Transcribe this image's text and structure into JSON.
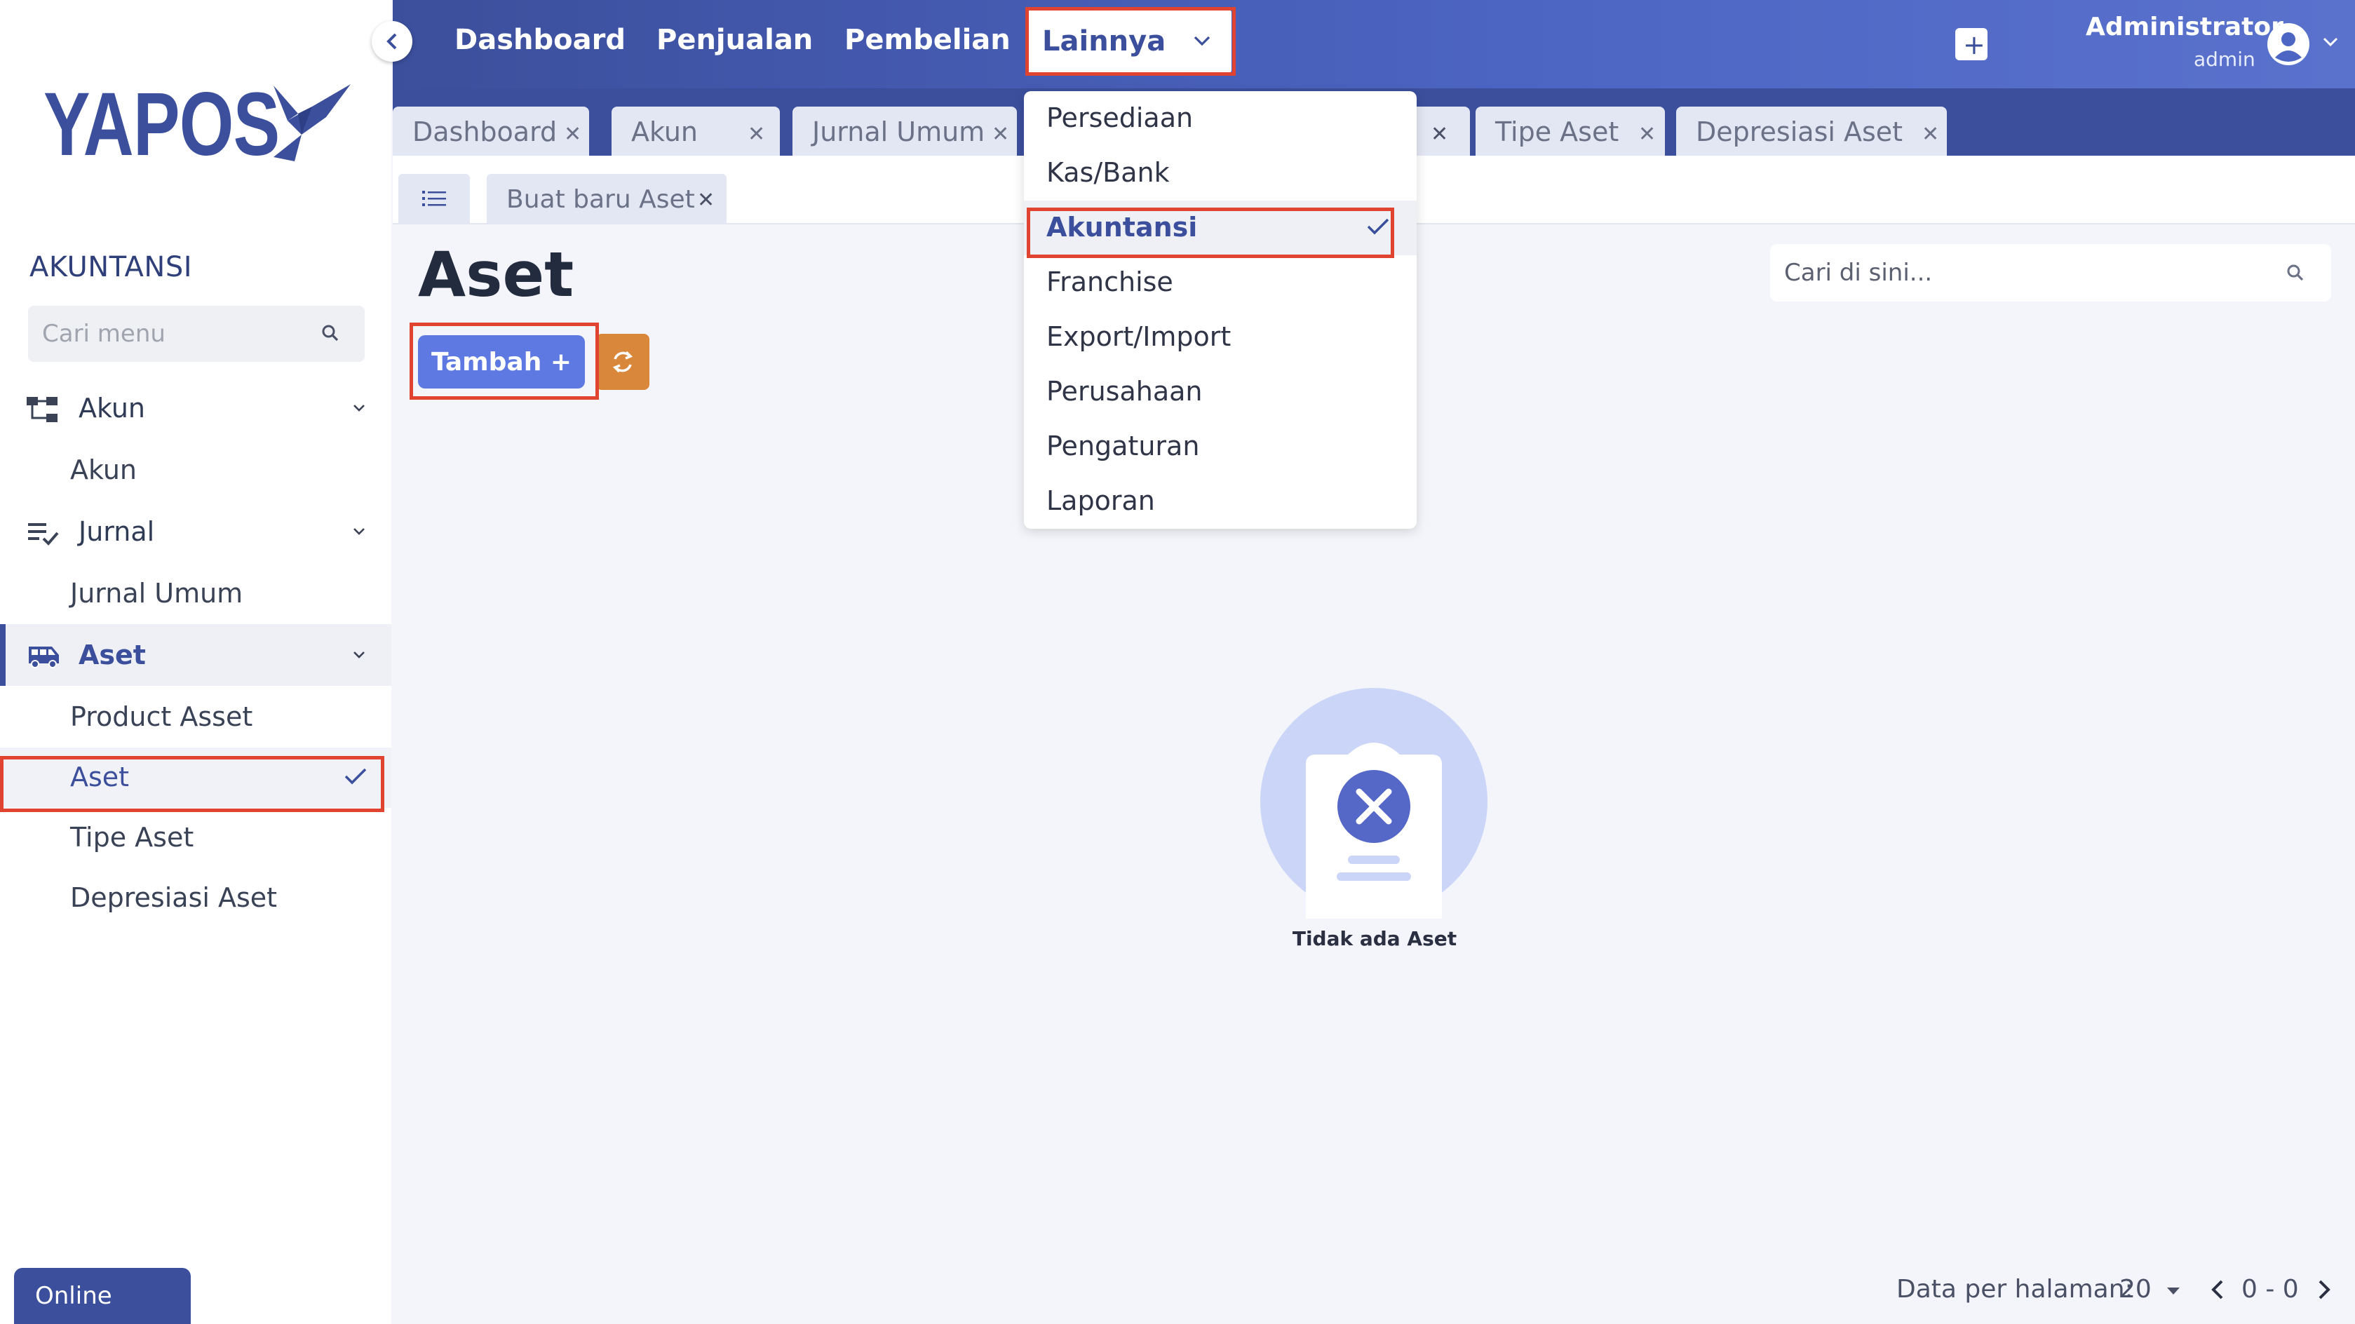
{
  "sidebar": {
    "logo_text": "YAPOS",
    "section_title": "AKUNTANSI",
    "search_placeholder": "Cari menu",
    "groups": [
      {
        "label": "Akun",
        "items": [
          "Akun"
        ]
      },
      {
        "label": "Jurnal",
        "items": [
          "Jurnal Umum"
        ]
      },
      {
        "label": "Aset",
        "items": [
          "Product Asset",
          "Aset",
          "Tipe Aset",
          "Depresiasi Aset"
        ]
      }
    ],
    "status": "Online"
  },
  "topbar": {
    "nav": [
      "Dashboard",
      "Penjualan",
      "Pembelian"
    ],
    "more_label": "Lainnya",
    "user_name": "Administrator",
    "user_role": "admin"
  },
  "tabs": [
    {
      "label": "Dashboard"
    },
    {
      "label": "Akun"
    },
    {
      "label": "Jurnal Umum"
    },
    {
      "label": "Tipe Aset"
    },
    {
      "label": "Depresiasi Aset"
    }
  ],
  "subtab": {
    "label": "Buat baru Aset"
  },
  "dropdown": {
    "items": [
      "Persediaan",
      "Kas/Bank",
      "Akuntansi",
      "Franchise",
      "Export/Import",
      "Perusahaan",
      "Pengaturan",
      "Laporan"
    ],
    "selected": "Akuntansi"
  },
  "main": {
    "title": "Aset",
    "add_button": "Tambah +",
    "search_placeholder": "Cari di sini...",
    "empty_text": "Tidak ada Aset"
  },
  "pagination": {
    "label": "Data per halaman:",
    "page_size": "20",
    "range": "0 - 0"
  },
  "colors": {
    "primary": "#3c4f9c",
    "button": "#5e79e2",
    "refresh": "#d9883b",
    "highlight": "#e0432f"
  }
}
